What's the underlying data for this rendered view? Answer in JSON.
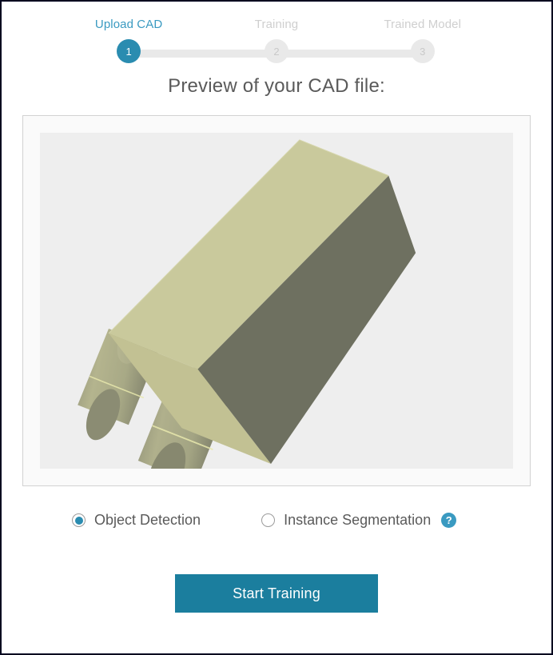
{
  "window": {
    "border_color": "#04061f",
    "background": "#ffffff"
  },
  "stepper": {
    "active_color": "#2a8cb0",
    "active_label_color": "#3a9ac1",
    "inactive_color": "#e9e9e9",
    "steps": [
      {
        "number": "1",
        "label": "Upload CAD",
        "state": "active"
      },
      {
        "number": "2",
        "label": "Training",
        "state": "inactive"
      },
      {
        "number": "3",
        "label": "Trained Model",
        "state": "inactive"
      }
    ]
  },
  "preview": {
    "heading": "Preview of your CAD file:",
    "canvas_background": "#eeeeee",
    "panel_background": "#fafafa",
    "panel_border": "#d2d2d2",
    "model": {
      "name": "cad-part-model",
      "light_face_color": "#c5c496",
      "dark_face_color": "#6e7060",
      "top_face_color": "#cbcb9e",
      "seam_color": "#e7e7ad"
    }
  },
  "mode_options": {
    "options": [
      {
        "id": "object-detection",
        "label": "Object Detection",
        "selected": true
      },
      {
        "id": "instance-segmentation",
        "label": "Instance Segmentation",
        "selected": false
      }
    ],
    "help_icon": "question-mark-icon",
    "help_glyph": "?",
    "accent_color": "#2a8cb0"
  },
  "actions": {
    "start_training_label": "Start Training",
    "start_training_color": "#1b7e9e"
  }
}
